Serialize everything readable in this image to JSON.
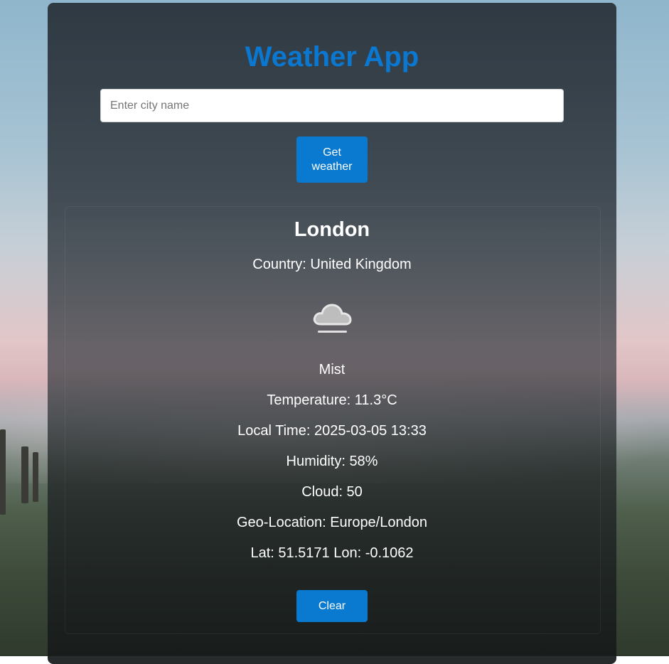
{
  "app": {
    "title": "Weather App"
  },
  "search": {
    "placeholder": "Enter city name",
    "value": "",
    "button_label": "Get weather"
  },
  "weather": {
    "city": "London",
    "country_line": "Country: United Kingdom",
    "icon": "mist-cloud-icon",
    "condition": "Mist",
    "temperature_line": "Temperature: 11.3°C",
    "local_time_line": "Local Time: 2025-03-05 13:33",
    "humidity_line": "Humidity: 58%",
    "cloud_line": "Cloud: 50",
    "geo_location_line": "Geo-Location: Europe/London",
    "coords_line": "Lat: 51.5171 Lon: -0.1062"
  },
  "actions": {
    "clear_label": "Clear"
  },
  "colors": {
    "accent": "#0a7ad0",
    "title": "#0a78d1",
    "text": "#ffffff"
  }
}
